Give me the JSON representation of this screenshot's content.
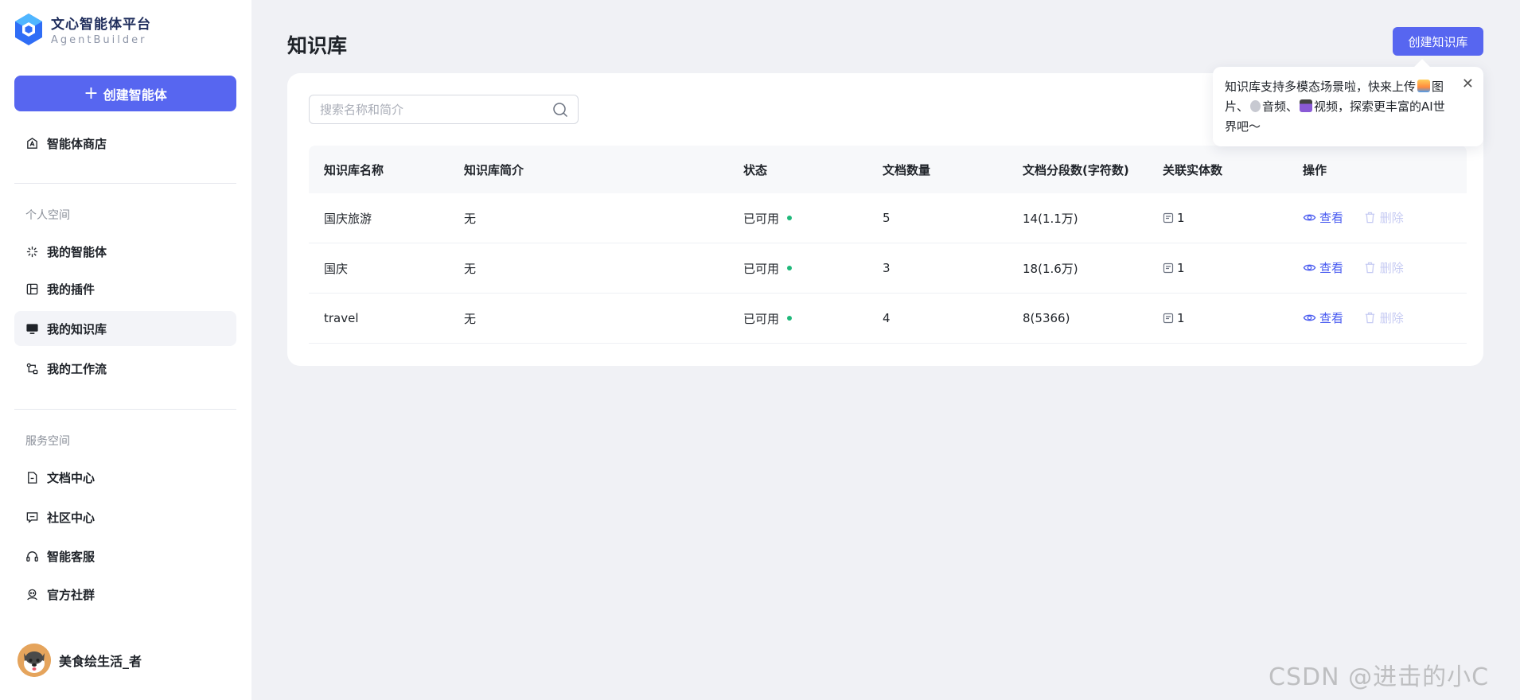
{
  "app": {
    "title": "文心智能体平台",
    "subtitle": "AgentBuilder",
    "brand_color": "#5766f0"
  },
  "sidebar": {
    "create_label": "创建智能体",
    "store_label": "智能体商店",
    "personal_section": "个人空间",
    "personal_items": [
      {
        "label": "我的智能体",
        "icon": "sparkle-icon"
      },
      {
        "label": "我的插件",
        "icon": "plugin-icon"
      },
      {
        "label": "我的知识库",
        "icon": "monitor-icon",
        "active": true
      },
      {
        "label": "我的工作流",
        "icon": "workflow-icon"
      }
    ],
    "service_section": "服务空间",
    "service_items": [
      {
        "label": "文档中心",
        "icon": "document-icon"
      },
      {
        "label": "社区中心",
        "icon": "chat-icon"
      },
      {
        "label": "智能客服",
        "icon": "headset-icon"
      },
      {
        "label": "官方社群",
        "icon": "community-icon"
      }
    ],
    "user_name": "美食绘生活_者"
  },
  "main": {
    "title": "知识库",
    "create_button": "创建知识库",
    "tooltip": {
      "part1": "知识库支持多模态场景啦，快来上传",
      "part2": "图片、",
      "part3": "音频、",
      "part4": "视频，探索更丰富的AI世界吧～"
    },
    "search_placeholder": "搜索名称和简介",
    "columns": [
      "知识库名称",
      "知识库简介",
      "状态",
      "文档数量",
      "文档分段数(字符数)",
      "关联实体数",
      "操作"
    ],
    "rows": [
      {
        "name": "国庆旅游",
        "desc": "无",
        "status": "已可用",
        "docs": "5",
        "segments": "14(1.1万)",
        "entities": "1"
      },
      {
        "name": "国庆",
        "desc": "无",
        "status": "已可用",
        "docs": "3",
        "segments": "18(1.6万)",
        "entities": "1"
      },
      {
        "name": "travel",
        "desc": "无",
        "status": "已可用",
        "docs": "4",
        "segments": "8(5366)",
        "entities": "1"
      }
    ],
    "view_label": "查看",
    "delete_label": "删除"
  },
  "watermark": "CSDN @进击的小C"
}
